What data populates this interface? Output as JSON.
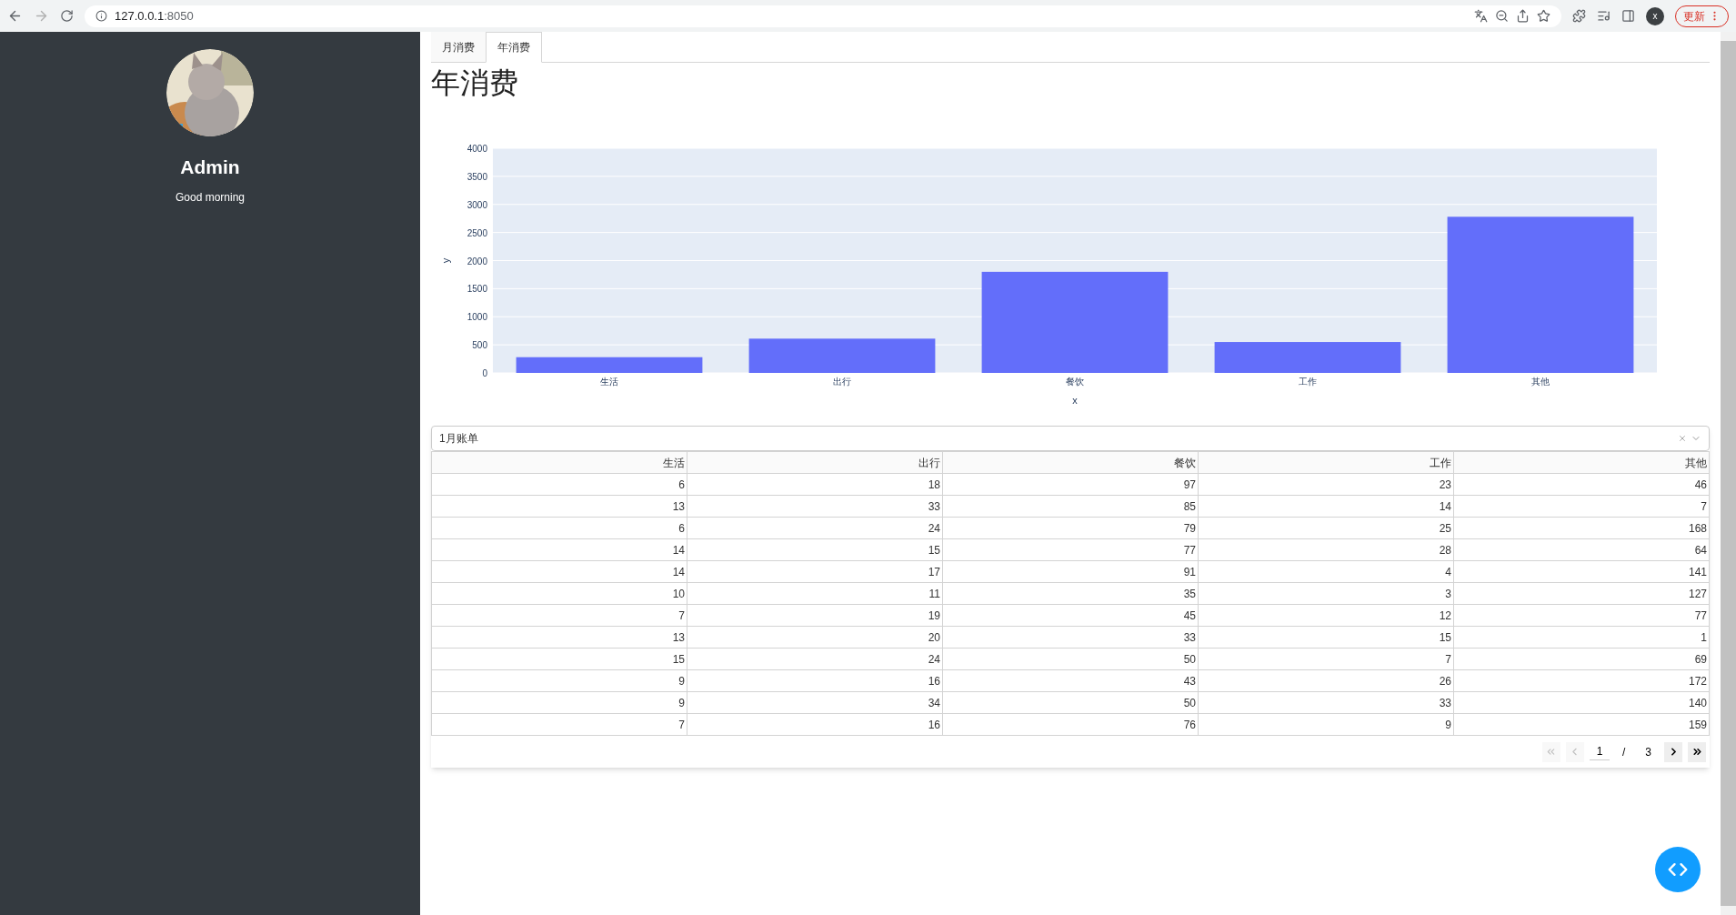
{
  "browser": {
    "url_host": "127.0.0.1",
    "url_port": ":8050",
    "profile_initial": "x",
    "update_label": "更新"
  },
  "sidebar": {
    "name": "Admin",
    "greeting": "Good morning"
  },
  "tabs": [
    {
      "label": "月消费",
      "selected": false
    },
    {
      "label": "年消费",
      "selected": true
    }
  ],
  "page_title": "年消费",
  "chart": {
    "chart_data": {
      "type": "bar",
      "xlabel": "x",
      "ylabel": "y",
      "categories": [
        "生活",
        "出行",
        "餐饮",
        "工作",
        "其他"
      ],
      "grid": true,
      "series": [
        {
          "color": "#636efa",
          "values": [
            280,
            610,
            1800,
            550,
            2780
          ]
        }
      ],
      "ylim": [
        0,
        4000
      ],
      "yticks": [
        0,
        500,
        1000,
        1500,
        2000,
        2500,
        3000,
        3500,
        4000
      ]
    }
  },
  "bill_select": {
    "value": "1月账单"
  },
  "table": {
    "columns": [
      "生活",
      "出行",
      "餐饮",
      "工作",
      "其他"
    ],
    "rows": [
      [
        "6",
        "18",
        "97",
        "23",
        "46"
      ],
      [
        "13",
        "33",
        "85",
        "14",
        "7"
      ],
      [
        "6",
        "24",
        "79",
        "25",
        "168"
      ],
      [
        "14",
        "15",
        "77",
        "28",
        "64"
      ],
      [
        "14",
        "17",
        "91",
        "4",
        "141"
      ],
      [
        "10",
        "11",
        "35",
        "3",
        "127"
      ],
      [
        "7",
        "19",
        "45",
        "12",
        "77"
      ],
      [
        "13",
        "20",
        "33",
        "15",
        "1"
      ],
      [
        "15",
        "24",
        "50",
        "7",
        "69"
      ],
      [
        "9",
        "16",
        "43",
        "26",
        "172"
      ],
      [
        "9",
        "34",
        "50",
        "33",
        "140"
      ],
      [
        "7",
        "16",
        "76",
        "9",
        "159"
      ]
    ]
  },
  "pagination": {
    "current_page": "1",
    "separator": "/",
    "total_pages": "3",
    "first_disabled": true,
    "prev_disabled": true,
    "next_disabled": false,
    "last_disabled": false
  }
}
